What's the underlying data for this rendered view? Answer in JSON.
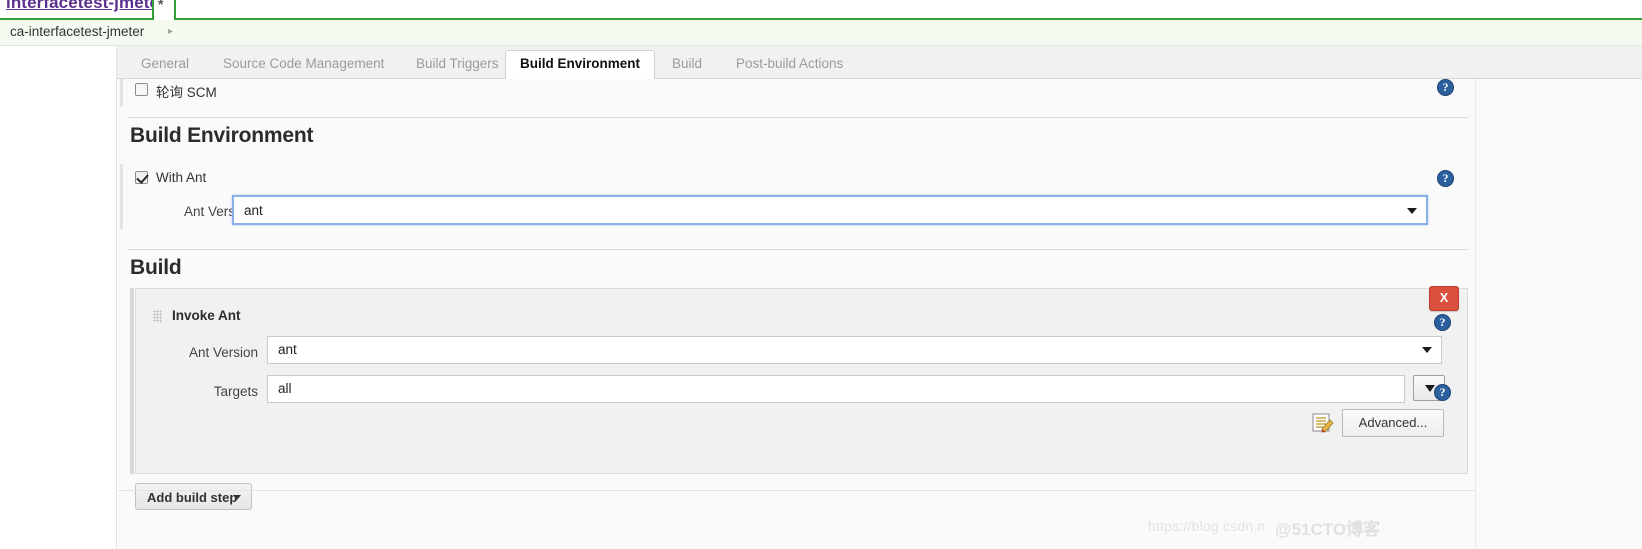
{
  "browser": {
    "tab_title": "interfacetest-jmeter",
    "tab_marker": "*"
  },
  "breadcrumb": {
    "item": "ca-interfacetest-jmeter",
    "separator": "▸"
  },
  "tabs": [
    {
      "label": "General",
      "active": false
    },
    {
      "label": "Source Code Management",
      "active": false
    },
    {
      "label": "Build Triggers",
      "active": false
    },
    {
      "label": "Build Environment",
      "active": true
    },
    {
      "label": "Build",
      "active": false
    },
    {
      "label": "Post-build Actions",
      "active": false
    }
  ],
  "scm_poll": {
    "label": "轮询 SCM",
    "checked": false,
    "help_icon": "help-icon"
  },
  "build_environment": {
    "heading": "Build Environment",
    "with_ant": {
      "label": "With Ant",
      "checked": true,
      "help_icon": "help-icon"
    },
    "ant_version": {
      "label": "Ant Version",
      "value": "ant",
      "options": [
        "ant"
      ],
      "caret_icon": "chevron-down-icon",
      "focused": true
    }
  },
  "build": {
    "heading": "Build",
    "step": {
      "grip_icon": "drag-handle-icon",
      "title": "Invoke Ant",
      "delete_label": "X",
      "delete_help_icon": "help-icon",
      "ant_version": {
        "label": "Ant Version",
        "value": "ant",
        "options": [
          "ant"
        ],
        "caret_icon": "chevron-down-icon"
      },
      "targets": {
        "label": "Targets",
        "value": "all",
        "dropdown_icon": "chevron-down-icon",
        "help_icon": "help-icon"
      },
      "notepad_icon": "notepad-pencil-icon",
      "advanced_label": "Advanced..."
    },
    "add_build_step": {
      "label": "Add build step",
      "caret_icon": "chevron-down-icon"
    }
  },
  "watermark": {
    "url": "https://blog.csdn.n",
    "logo": "@51CTO博客"
  },
  "colors": {
    "accent_green": "#35a035",
    "link_purple": "#5b2f8e",
    "danger_red": "#d9503f",
    "help_blue": "#2c5f9e",
    "focus_blue": "#8ab0e8"
  }
}
